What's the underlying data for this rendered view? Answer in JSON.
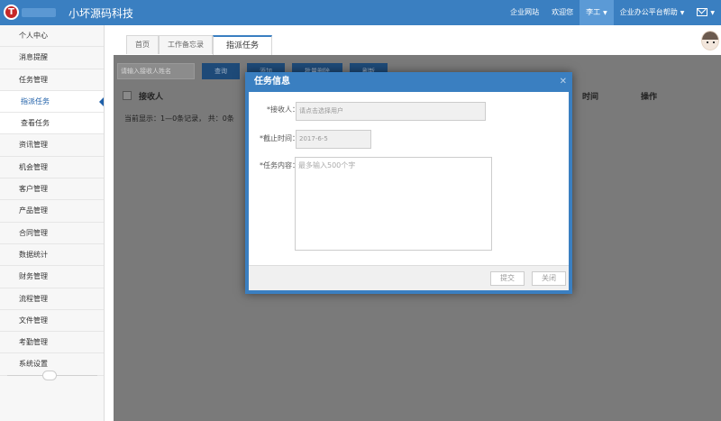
{
  "header": {
    "logo_letter": "T",
    "app_title": "小坏源码科技",
    "nav": [
      {
        "label": "企业网站"
      },
      {
        "label": "欢迎您"
      },
      {
        "label": "李工"
      },
      {
        "label": "企业办公平台帮助"
      }
    ]
  },
  "sidebar": {
    "items": [
      {
        "label": "个人中心"
      },
      {
        "label": "消息提醒"
      },
      {
        "label": "任务管理"
      },
      {
        "label": "指派任务"
      },
      {
        "label": "查看任务"
      },
      {
        "label": "资讯管理"
      },
      {
        "label": "机会管理"
      },
      {
        "label": "客户管理"
      },
      {
        "label": "产品管理"
      },
      {
        "label": "合同管理"
      },
      {
        "label": "数据统计"
      },
      {
        "label": "财务管理"
      },
      {
        "label": "流程管理"
      },
      {
        "label": "文件管理"
      },
      {
        "label": "考勤管理"
      },
      {
        "label": "系统设置"
      }
    ]
  },
  "tabs": [
    {
      "label": "首页"
    },
    {
      "label": "工作备忘录"
    },
    {
      "label": "指派任务"
    }
  ],
  "toolbar": {
    "search_placeholder": "请输入接收人姓名",
    "buttons": [
      "查询",
      "添加",
      "批量删除",
      "刷新"
    ]
  },
  "grid": {
    "columns": [
      "接收人",
      "时间",
      "操作"
    ],
    "paging_text": "当前显示：1—0条记录，  共：0条"
  },
  "modal": {
    "title": "任务信息",
    "close_glyph": "✕",
    "receiver_label": "*接收人：",
    "receiver_placeholder": "请点击选择用户",
    "deadline_label": "*截止时间：",
    "deadline_value": "2017-6-5",
    "content_label": "*任务内容：",
    "content_placeholder": "最多输入500个字",
    "submit_label": "提交",
    "close_label": "关闭"
  },
  "colors": {
    "accent": "#3a7fc1",
    "overlay": "#7a7a7a",
    "active_nav": "#1e5fa8"
  }
}
